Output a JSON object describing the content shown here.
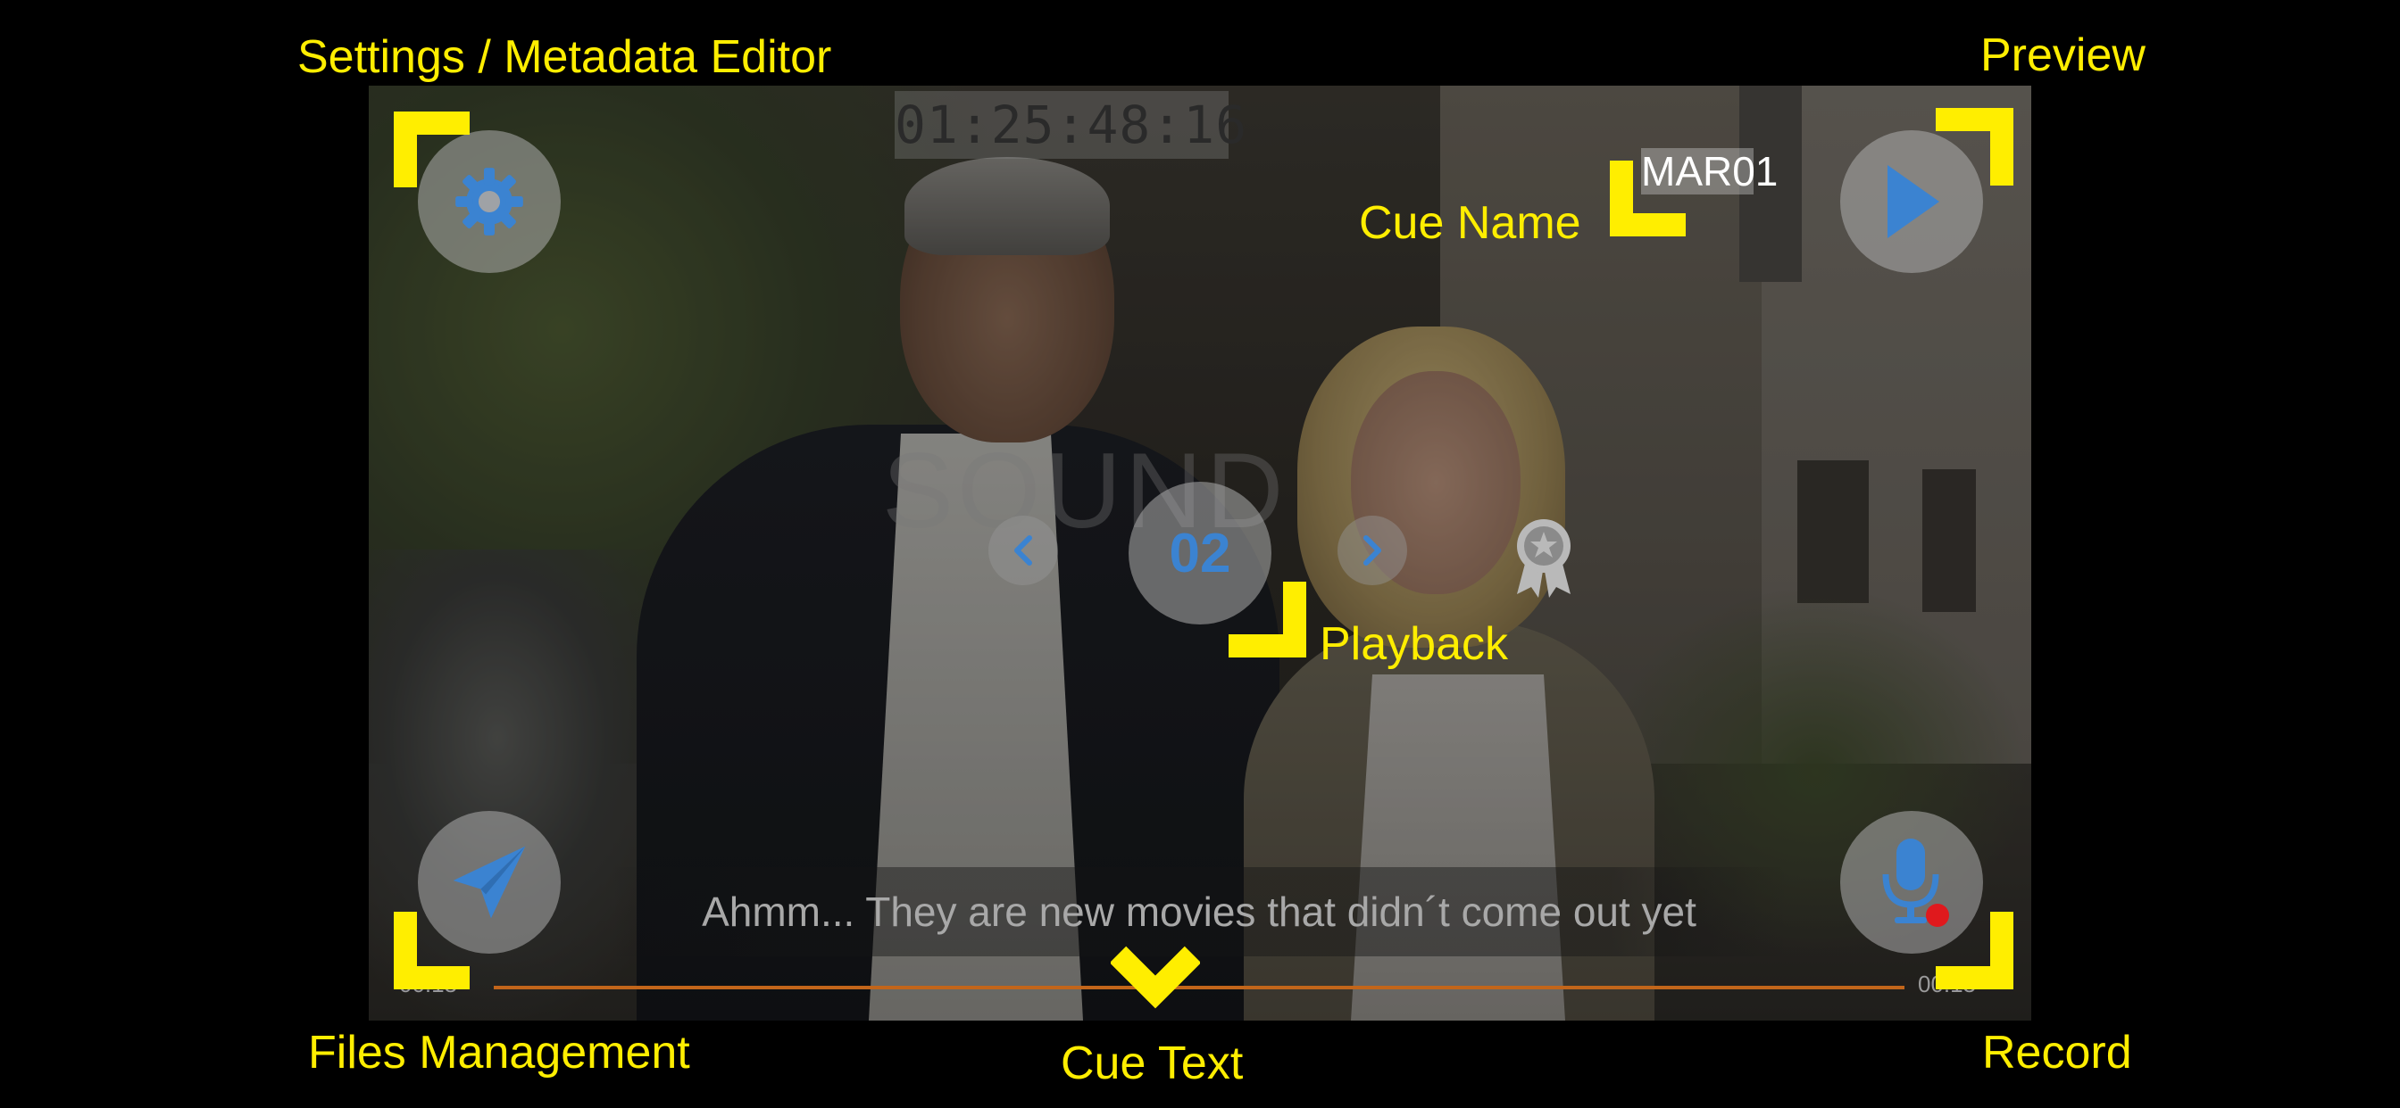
{
  "video": {
    "timecode": "01:25:48:16",
    "cue_name": "MAR01",
    "watermark": "SOUND",
    "cue_number": "02",
    "cue_text": "Ahmm... They are new movies that didn´t come out yet",
    "time_elapsed": "00:15",
    "time_total": "00:15",
    "progress_fraction": 1.0
  },
  "icons": {
    "settings": "gear-icon",
    "preview": "play-icon",
    "files": "paper-plane-icon",
    "record": "microphone-icon",
    "prev": "chevron-left-icon",
    "next": "chevron-right-icon",
    "award": "award-ribbon-icon"
  },
  "colors": {
    "annotation": "#ffee00",
    "accent_blue": "#3b83d1",
    "progress": "#c2651a",
    "record_dot": "#e0191d"
  },
  "annotations": {
    "settings": "Settings / Metadata Editor",
    "preview": "Preview",
    "cue_name": "Cue Name",
    "playback": "Playback",
    "files": "Files Management",
    "cue_text": "Cue Text",
    "record": "Record"
  }
}
